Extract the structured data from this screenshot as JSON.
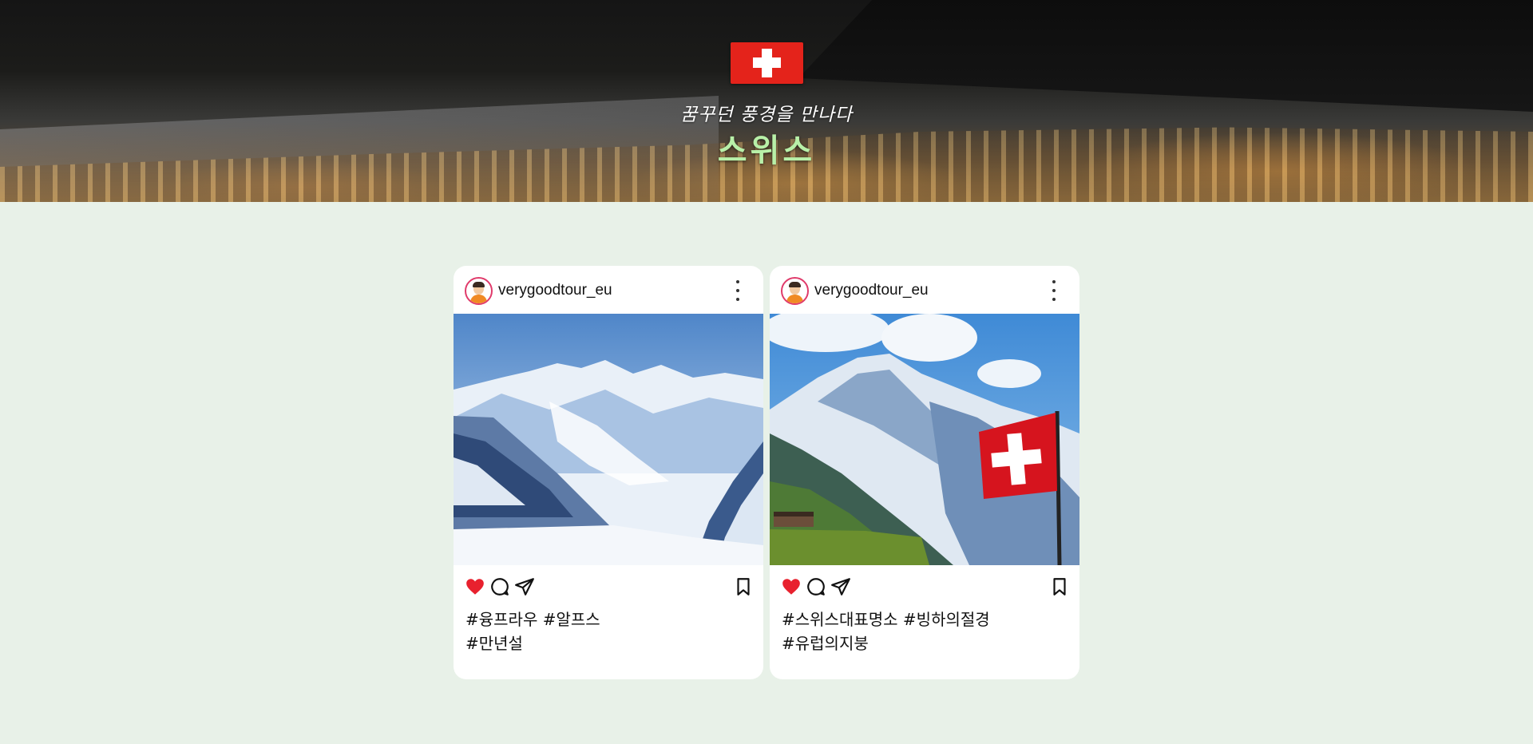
{
  "hero": {
    "subtitle": "꿈꾸던 풍경을 만나다",
    "title": "스위스",
    "flag_color": "#e4231b",
    "title_color": "#b8f0a8"
  },
  "cards": [
    {
      "username": "verygoodtour_eu",
      "photo_subject": "snowy alpine glacier and mountain peaks",
      "hashtag_lines": [
        "#융프라우 #알프스",
        "#만년설"
      ],
      "liked": true
    },
    {
      "username": "verygoodtour_eu",
      "photo_subject": "snow-capped mountain with Swiss flag",
      "hashtag_lines": [
        "#스위스대표명소 #빙하의절경",
        "#유럽의지붕"
      ],
      "liked": true
    }
  ],
  "icons": {
    "like": "heart-icon",
    "comment": "comment-icon",
    "share": "send-icon",
    "save": "bookmark-icon",
    "more": "more-vertical-icon"
  },
  "colors": {
    "page_background": "#e8f1e8",
    "like_red": "#e8212e",
    "avatar_ring": "#e03b6b"
  }
}
